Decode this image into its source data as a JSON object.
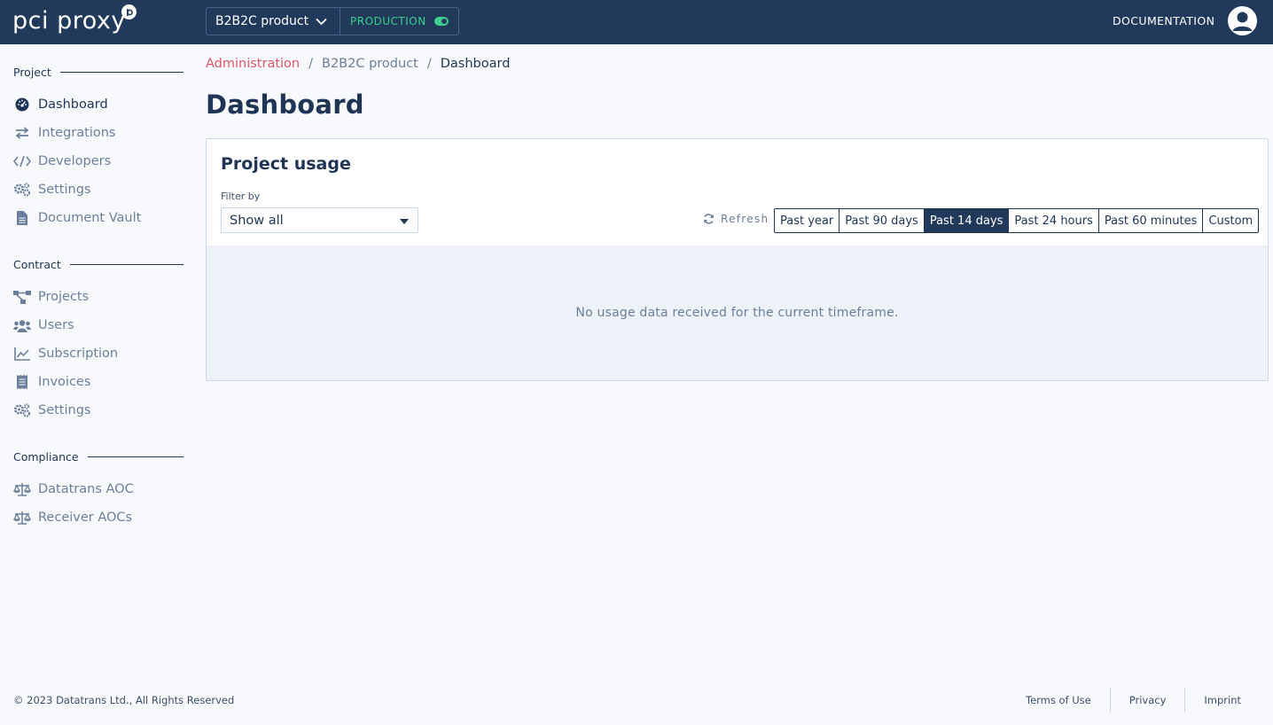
{
  "brand": {
    "logo_text": "pci proxy"
  },
  "topbar": {
    "project_name": "B2B2C product",
    "environment": "PRODUCTION",
    "documentation": "DOCUMENTATION"
  },
  "sidebar": {
    "sections": [
      {
        "title": "Project",
        "items": [
          "Dashboard",
          "Integrations",
          "Developers",
          "Settings",
          "Document Vault"
        ]
      },
      {
        "title": "Contract",
        "items": [
          "Projects",
          "Users",
          "Subscription",
          "Invoices",
          "Settings"
        ]
      },
      {
        "title": "Compliance",
        "items": [
          "Datatrans AOC",
          "Receiver AOCs"
        ]
      }
    ],
    "active_item": "Dashboard"
  },
  "breadcrumb": [
    "Administration",
    "B2B2C product",
    "Dashboard"
  ],
  "page": {
    "title": "Dashboard"
  },
  "usage_card": {
    "title": "Project usage",
    "filter_label": "Filter by",
    "filter_value": "Show all",
    "refresh_label": "Refresh",
    "ranges": [
      "Past year",
      "Past 90 days",
      "Past 14 days",
      "Past 24 hours",
      "Past 60 minutes",
      "Custom"
    ],
    "active_range": "Past 14 days",
    "empty_message": "No usage data received for the current timeframe."
  },
  "footer": {
    "copyright": "© 2023 Datatrans Ltd., All Rights Reserved",
    "links": [
      "Terms of Use",
      "Privacy",
      "Imprint"
    ]
  },
  "colors": {
    "header_bg": "#213a5c",
    "accent_link": "#e0556a",
    "production_green": "#3ecf8e",
    "text_dark": "#1e3556",
    "text_muted": "#6a7f9b"
  }
}
